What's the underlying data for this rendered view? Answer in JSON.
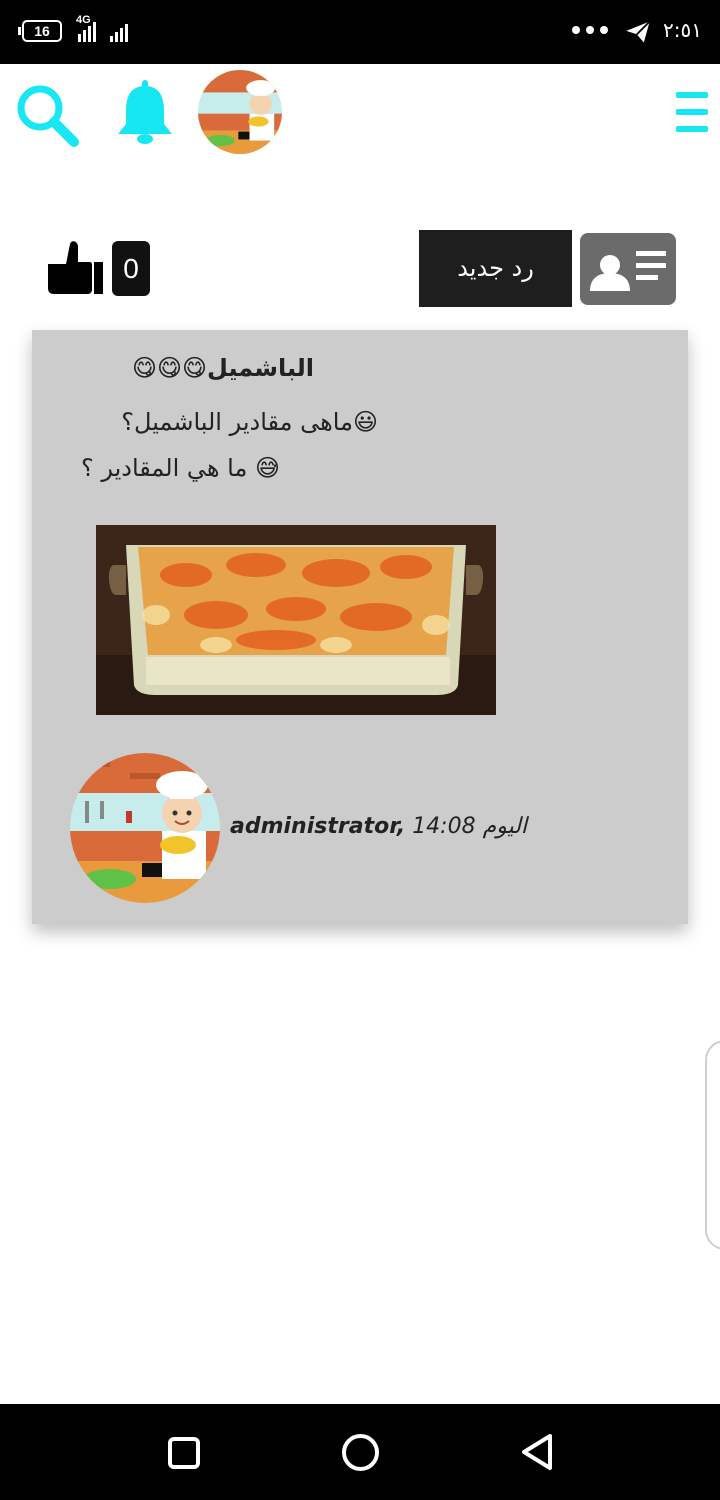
{
  "status_bar": {
    "battery": "16",
    "network": "4G",
    "time": "٢:٥١"
  },
  "header": {
    "accent_color": "#17e6f3"
  },
  "actions": {
    "like_count": "0",
    "reply_label": "رد جديد"
  },
  "post": {
    "title": "الباشميل😋😋😋",
    "body_line_1": "😃ماهى مقادير الباشميل؟",
    "body_line_2": "😅 ما هي المقادير ؟",
    "author": "administrator,",
    "time": "14:08",
    "day": "اليوم"
  }
}
